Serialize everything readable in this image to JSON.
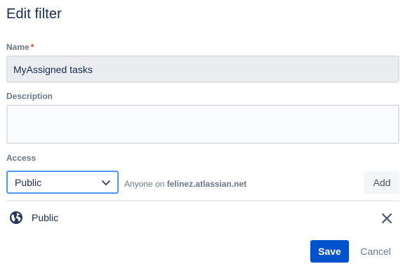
{
  "dialog": {
    "title": "Edit filter"
  },
  "name_field": {
    "label": "Name",
    "required_mark": "*",
    "value": "MyAssigned tasks"
  },
  "description_field": {
    "label": "Description",
    "value": ""
  },
  "access": {
    "label": "Access",
    "select_value": "Public",
    "hint_prefix": "Anyone on",
    "hint_domain": "felinez.atlassian.net",
    "add_label": "Add",
    "entries": [
      {
        "label": "Public",
        "icon": "globe-icon"
      }
    ]
  },
  "footer": {
    "save_label": "Save",
    "cancel_label": "Cancel"
  },
  "colors": {
    "primary": "#0052cc",
    "required": "#de350b",
    "focus_border": "#4c9aff",
    "muted_text": "#6b778c",
    "heading_text": "#172b4d"
  }
}
